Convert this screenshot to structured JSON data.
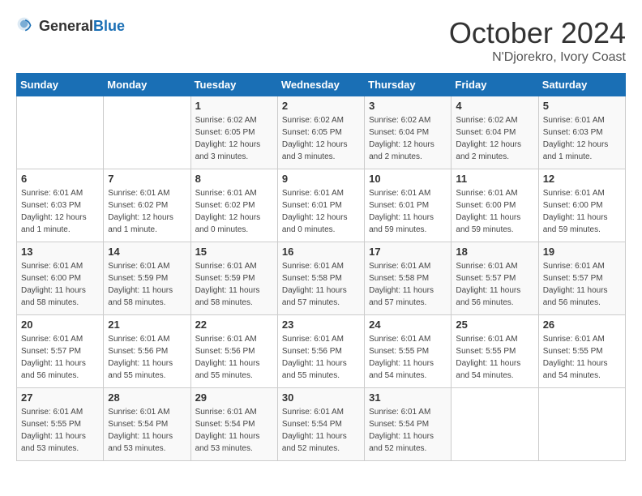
{
  "logo": {
    "general": "General",
    "blue": "Blue"
  },
  "title": "October 2024",
  "location": "N'Djorekro, Ivory Coast",
  "days_of_week": [
    "Sunday",
    "Monday",
    "Tuesday",
    "Wednesday",
    "Thursday",
    "Friday",
    "Saturday"
  ],
  "weeks": [
    [
      {
        "day": "",
        "info": ""
      },
      {
        "day": "",
        "info": ""
      },
      {
        "day": "1",
        "info": "Sunrise: 6:02 AM\nSunset: 6:05 PM\nDaylight: 12 hours and 3 minutes."
      },
      {
        "day": "2",
        "info": "Sunrise: 6:02 AM\nSunset: 6:05 PM\nDaylight: 12 hours and 3 minutes."
      },
      {
        "day": "3",
        "info": "Sunrise: 6:02 AM\nSunset: 6:04 PM\nDaylight: 12 hours and 2 minutes."
      },
      {
        "day": "4",
        "info": "Sunrise: 6:02 AM\nSunset: 6:04 PM\nDaylight: 12 hours and 2 minutes."
      },
      {
        "day": "5",
        "info": "Sunrise: 6:01 AM\nSunset: 6:03 PM\nDaylight: 12 hours and 1 minute."
      }
    ],
    [
      {
        "day": "6",
        "info": "Sunrise: 6:01 AM\nSunset: 6:03 PM\nDaylight: 12 hours and 1 minute."
      },
      {
        "day": "7",
        "info": "Sunrise: 6:01 AM\nSunset: 6:02 PM\nDaylight: 12 hours and 1 minute."
      },
      {
        "day": "8",
        "info": "Sunrise: 6:01 AM\nSunset: 6:02 PM\nDaylight: 12 hours and 0 minutes."
      },
      {
        "day": "9",
        "info": "Sunrise: 6:01 AM\nSunset: 6:01 PM\nDaylight: 12 hours and 0 minutes."
      },
      {
        "day": "10",
        "info": "Sunrise: 6:01 AM\nSunset: 6:01 PM\nDaylight: 11 hours and 59 minutes."
      },
      {
        "day": "11",
        "info": "Sunrise: 6:01 AM\nSunset: 6:00 PM\nDaylight: 11 hours and 59 minutes."
      },
      {
        "day": "12",
        "info": "Sunrise: 6:01 AM\nSunset: 6:00 PM\nDaylight: 11 hours and 59 minutes."
      }
    ],
    [
      {
        "day": "13",
        "info": "Sunrise: 6:01 AM\nSunset: 6:00 PM\nDaylight: 11 hours and 58 minutes."
      },
      {
        "day": "14",
        "info": "Sunrise: 6:01 AM\nSunset: 5:59 PM\nDaylight: 11 hours and 58 minutes."
      },
      {
        "day": "15",
        "info": "Sunrise: 6:01 AM\nSunset: 5:59 PM\nDaylight: 11 hours and 58 minutes."
      },
      {
        "day": "16",
        "info": "Sunrise: 6:01 AM\nSunset: 5:58 PM\nDaylight: 11 hours and 57 minutes."
      },
      {
        "day": "17",
        "info": "Sunrise: 6:01 AM\nSunset: 5:58 PM\nDaylight: 11 hours and 57 minutes."
      },
      {
        "day": "18",
        "info": "Sunrise: 6:01 AM\nSunset: 5:57 PM\nDaylight: 11 hours and 56 minutes."
      },
      {
        "day": "19",
        "info": "Sunrise: 6:01 AM\nSunset: 5:57 PM\nDaylight: 11 hours and 56 minutes."
      }
    ],
    [
      {
        "day": "20",
        "info": "Sunrise: 6:01 AM\nSunset: 5:57 PM\nDaylight: 11 hours and 56 minutes."
      },
      {
        "day": "21",
        "info": "Sunrise: 6:01 AM\nSunset: 5:56 PM\nDaylight: 11 hours and 55 minutes."
      },
      {
        "day": "22",
        "info": "Sunrise: 6:01 AM\nSunset: 5:56 PM\nDaylight: 11 hours and 55 minutes."
      },
      {
        "day": "23",
        "info": "Sunrise: 6:01 AM\nSunset: 5:56 PM\nDaylight: 11 hours and 55 minutes."
      },
      {
        "day": "24",
        "info": "Sunrise: 6:01 AM\nSunset: 5:55 PM\nDaylight: 11 hours and 54 minutes."
      },
      {
        "day": "25",
        "info": "Sunrise: 6:01 AM\nSunset: 5:55 PM\nDaylight: 11 hours and 54 minutes."
      },
      {
        "day": "26",
        "info": "Sunrise: 6:01 AM\nSunset: 5:55 PM\nDaylight: 11 hours and 54 minutes."
      }
    ],
    [
      {
        "day": "27",
        "info": "Sunrise: 6:01 AM\nSunset: 5:55 PM\nDaylight: 11 hours and 53 minutes."
      },
      {
        "day": "28",
        "info": "Sunrise: 6:01 AM\nSunset: 5:54 PM\nDaylight: 11 hours and 53 minutes."
      },
      {
        "day": "29",
        "info": "Sunrise: 6:01 AM\nSunset: 5:54 PM\nDaylight: 11 hours and 53 minutes."
      },
      {
        "day": "30",
        "info": "Sunrise: 6:01 AM\nSunset: 5:54 PM\nDaylight: 11 hours and 52 minutes."
      },
      {
        "day": "31",
        "info": "Sunrise: 6:01 AM\nSunset: 5:54 PM\nDaylight: 11 hours and 52 minutes."
      },
      {
        "day": "",
        "info": ""
      },
      {
        "day": "",
        "info": ""
      }
    ]
  ]
}
